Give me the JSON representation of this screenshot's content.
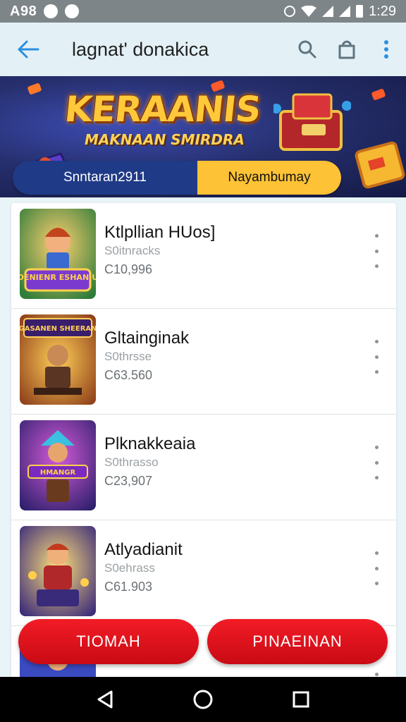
{
  "status_bar": {
    "left_text": "A98",
    "time": "1:29",
    "icons": [
      "notification-icon",
      "chat-icon",
      "alarm-icon",
      "wifi-icon",
      "signal-icon",
      "signal-icon",
      "battery-icon"
    ]
  },
  "app_bar": {
    "title": "lagnat' donakica",
    "icons": [
      "back-arrow-icon",
      "search-icon",
      "shopping-bag-icon",
      "more-vert-icon"
    ]
  },
  "banner": {
    "title": "KERAANIS",
    "subtitle": "MAKNAAN SMIRDRA",
    "pill_left": "Snntaran2911",
    "pill_right": "Nayambumay"
  },
  "list": {
    "items": [
      {
        "title": "Ktlpllian HUos]",
        "subtitle": "S0itnracks",
        "number": "C10,996",
        "thumb_text": "DENIENR ESHANIU"
      },
      {
        "title": "Gltainginak",
        "subtitle": "S0thrsse",
        "number": "C63.560",
        "thumb_text": "GASANEN SHEERAN"
      },
      {
        "title": "Plknakkeaia",
        "subtitle": "S0thrasso",
        "number": "C23,907",
        "thumb_text": "HMANGR"
      },
      {
        "title": "Atlyadianit",
        "subtitle": "S0ehrass",
        "number": "C61.903",
        "thumb_text": ""
      }
    ]
  },
  "actions": {
    "left_label": "TIOMAH",
    "right_label": "PINAEINAN"
  },
  "colors": {
    "accent": "#2a8fe0",
    "action": "#e01420",
    "pill_left": "#1f3a86",
    "pill_right": "#fdc235"
  }
}
